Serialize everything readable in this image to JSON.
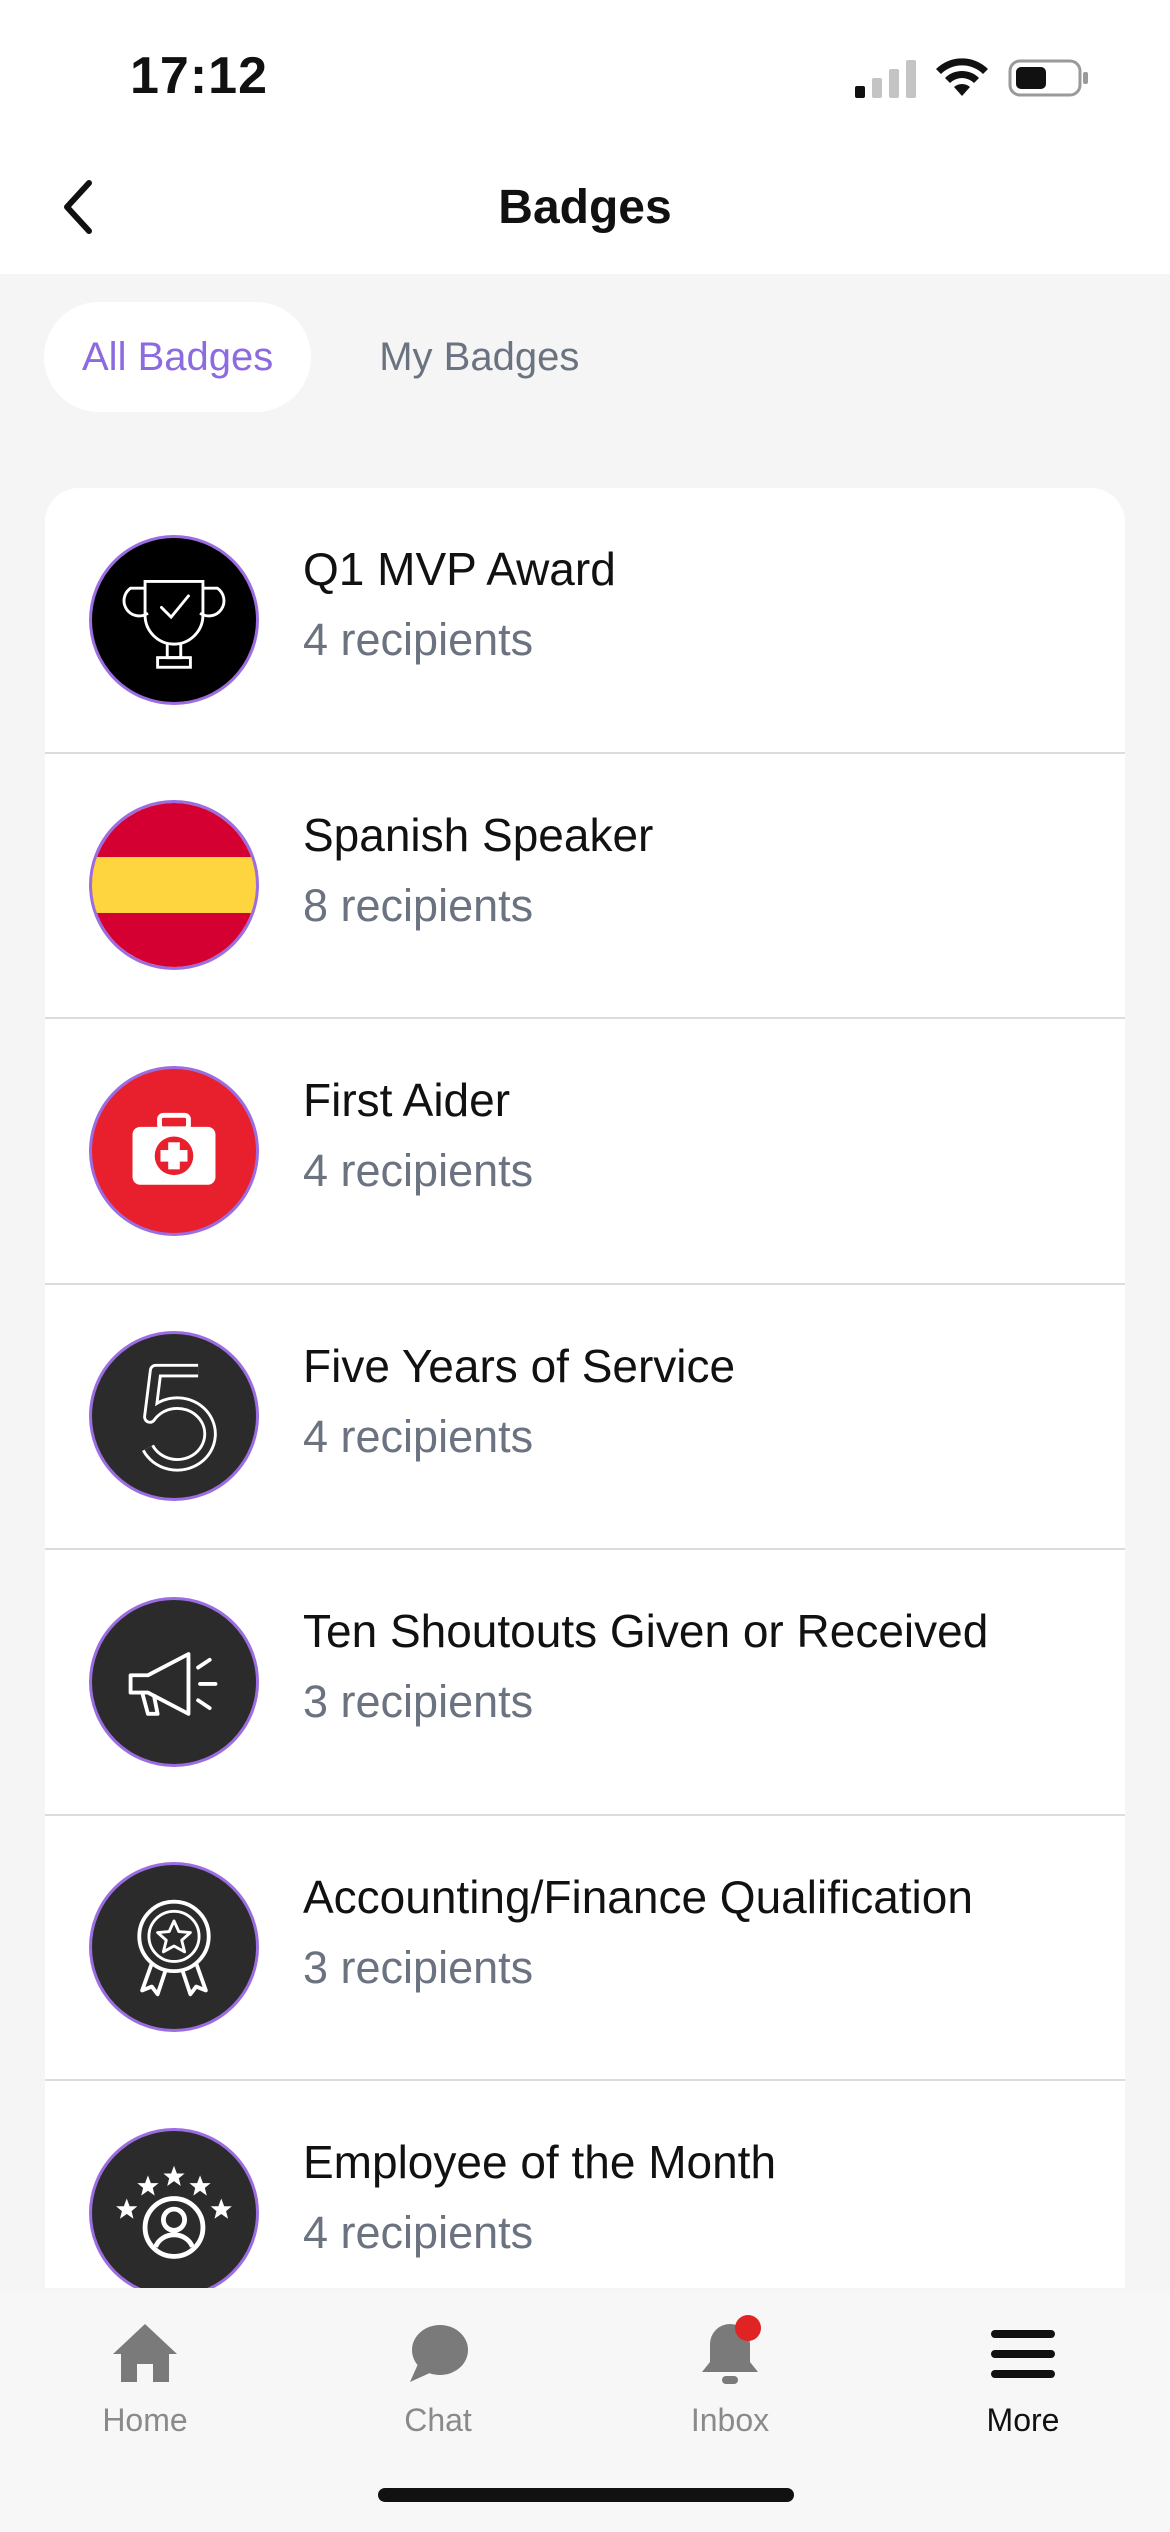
{
  "status_bar": {
    "time": "17:12"
  },
  "nav": {
    "title": "Badges"
  },
  "tabs": [
    {
      "label": "All Badges",
      "active": true
    },
    {
      "label": "My Badges",
      "active": false
    }
  ],
  "badges": [
    {
      "name": "Q1 MVP Award",
      "recipients": "4 recipients",
      "icon": "trophy-icon",
      "bg": "#000000"
    },
    {
      "name": "Spanish Speaker",
      "recipients": "8 recipients",
      "icon": "spain-flag-icon",
      "bg": "#d50032"
    },
    {
      "name": "First Aider",
      "recipients": "4 recipients",
      "icon": "first-aid-kit-icon",
      "bg": "#e8202e"
    },
    {
      "name": "Five Years of Service",
      "recipients": "4 recipients",
      "icon": "number-five-icon",
      "bg": "#2b2b2b"
    },
    {
      "name": "Ten Shoutouts Given or Received",
      "recipients": "3 recipients",
      "icon": "megaphone-icon",
      "bg": "#2b2b2b"
    },
    {
      "name": "Accounting/Finance Qualification",
      "recipients": "3 recipients",
      "icon": "award-ribbon-icon",
      "bg": "#2b2b2b"
    },
    {
      "name": "Employee of the Month",
      "recipients": "4 recipients",
      "icon": "star-employee-icon",
      "bg": "#2b2b2b"
    }
  ],
  "tab_bar": [
    {
      "label": "Home",
      "icon": "home-icon"
    },
    {
      "label": "Chat",
      "icon": "chat-icon"
    },
    {
      "label": "Inbox",
      "icon": "bell-icon",
      "has_notification": true
    },
    {
      "label": "More",
      "icon": "menu-icon",
      "active": true
    }
  ],
  "colors": {
    "accent": "#8c6ae0",
    "badge_border": "#9b6de0",
    "notification": "#e02424",
    "secondary_text": "#6b7280"
  }
}
